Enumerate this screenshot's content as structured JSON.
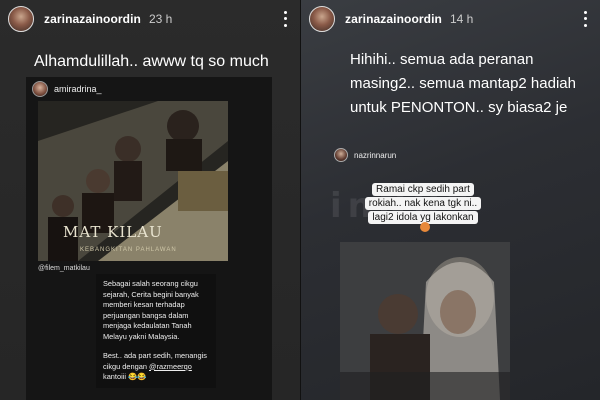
{
  "left_story": {
    "username": "zarinazainoordin",
    "time": "23 h",
    "caption": "Alhamdulillah.. awww tq so much",
    "embed": {
      "username": "amiradrina_",
      "poster_title": "MAT KILAU",
      "poster_subtitle": "KEBANGKITAN PAHLAWAN",
      "film_handle": "@filem_matkilau",
      "comment_para1": "Sebagai salah seorang cikgu sejarah, Cerita begini banyak memberi kesan terhadap perjuangan bangsa dalam menjaga kedaulatan Tanah Melayu yakni Malaysia.",
      "comment_para2_prefix": "Best.. ada part sedih, menangis cikgu dengan ",
      "comment_mention": "@razmeerqo",
      "comment_para2_suffix": " kantoiii 😂😂"
    }
  },
  "right_story": {
    "username": "zarinazainoordin",
    "time": "14 h",
    "caption": "Hihihi.. semua ada peranan masing2.. semua mantap2 hadiah untuk PENONTON.. sy biasa2 je",
    "embed": {
      "username": "nazrinnarun",
      "sticker_line1": "Ramai ckp sedih part",
      "sticker_line2": "rokiah.. nak kena tgk ni..",
      "sticker_line3": "lagi2 idola yg lakonkan"
    },
    "watermark": "inNUS"
  },
  "colors": {
    "left_bg": "#2b2b2b",
    "right_bg": "#3a3d42",
    "comment_bg": "#101010",
    "sticker_bg": "#f4f4f4"
  }
}
